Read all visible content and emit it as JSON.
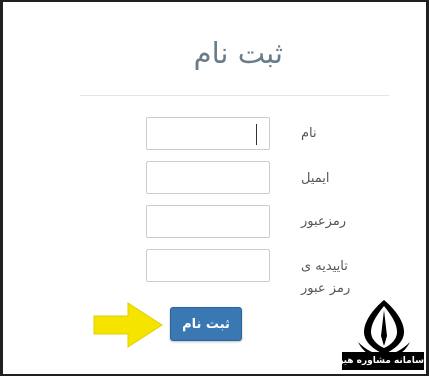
{
  "form": {
    "title": "ثبت نام",
    "fields": [
      {
        "label": "نام",
        "value": ""
      },
      {
        "label": "ایمیل",
        "value": ""
      },
      {
        "label": "رمزعبور",
        "value": ""
      },
      {
        "label_line1": "تاییدیه ی",
        "label_line2": "رمز عبور",
        "value": ""
      }
    ],
    "submit_label": "ثبت نام"
  },
  "annotation": {
    "arrow_color": "#f5e400",
    "arrow_icon": "arrow-right-icon"
  },
  "watermark": {
    "text": "سامانه مشاوره هیوا",
    "logo_icon": "pen-nib-icon"
  },
  "colors": {
    "button": "#3a78b4",
    "title": "#6a7c89"
  }
}
